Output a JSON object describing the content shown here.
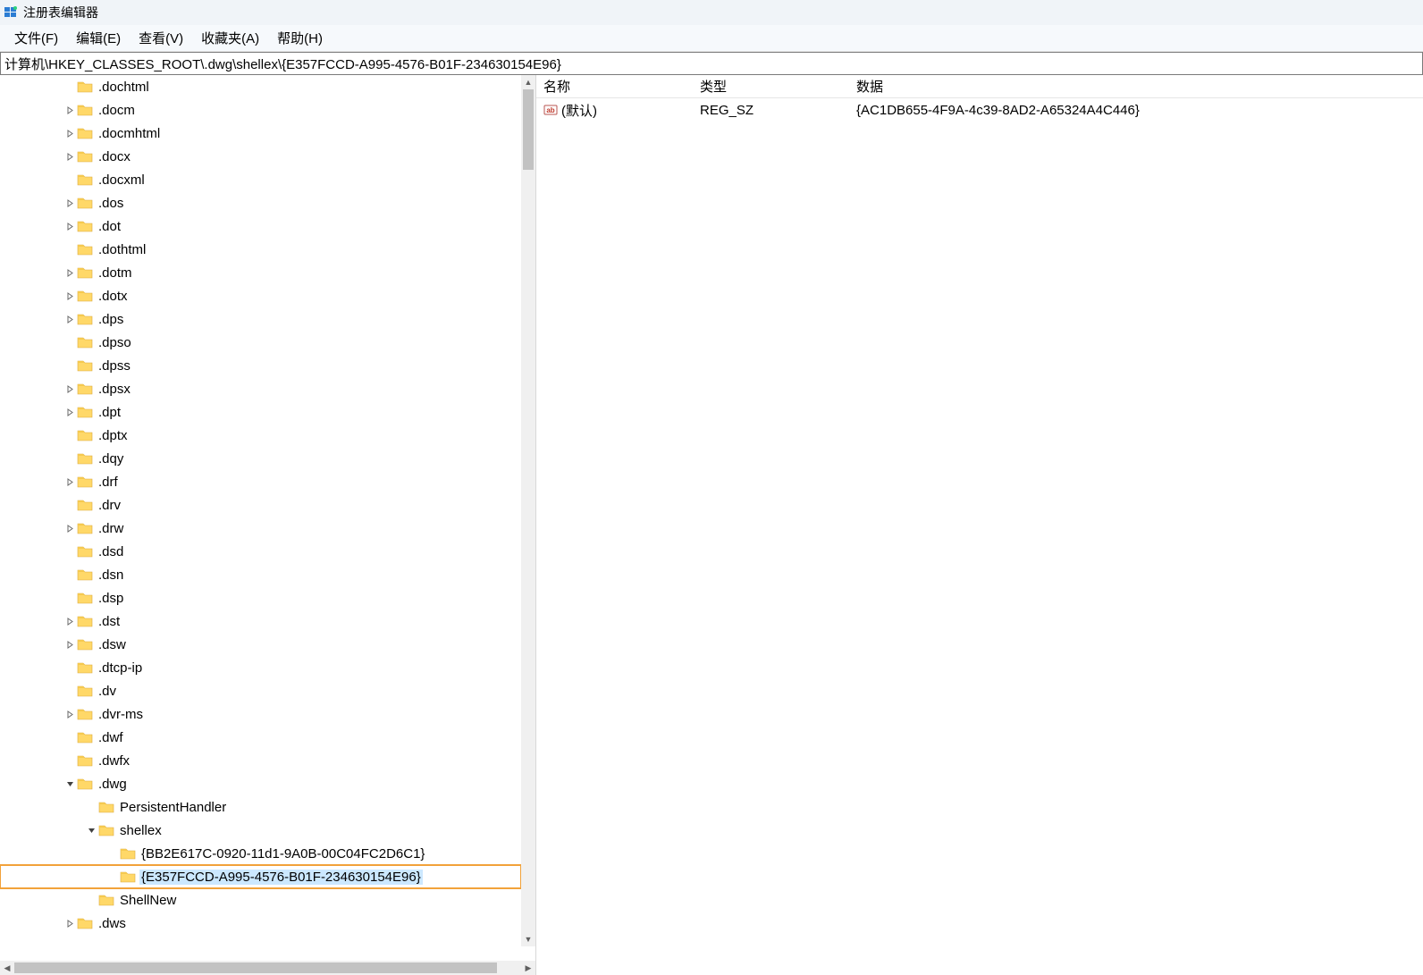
{
  "window": {
    "title": "注册表编辑器"
  },
  "menu": {
    "file": "文件(F)",
    "edit": "编辑(E)",
    "view": "查看(V)",
    "favorites": "收藏夹(A)",
    "help": "帮助(H)"
  },
  "address": "计算机\\HKEY_CLASSES_ROOT\\.dwg\\shellex\\{E357FCCD-A995-4576-B01F-234630154E96}",
  "tree": [
    {
      "indent": 2,
      "expander": "",
      "label": ".dochtml"
    },
    {
      "indent": 2,
      "expander": ">",
      "label": ".docm"
    },
    {
      "indent": 2,
      "expander": ">",
      "label": ".docmhtml"
    },
    {
      "indent": 2,
      "expander": ">",
      "label": ".docx"
    },
    {
      "indent": 2,
      "expander": "",
      "label": ".docxml"
    },
    {
      "indent": 2,
      "expander": ">",
      "label": ".dos"
    },
    {
      "indent": 2,
      "expander": ">",
      "label": ".dot"
    },
    {
      "indent": 2,
      "expander": "",
      "label": ".dothtml"
    },
    {
      "indent": 2,
      "expander": ">",
      "label": ".dotm"
    },
    {
      "indent": 2,
      "expander": ">",
      "label": ".dotx"
    },
    {
      "indent": 2,
      "expander": ">",
      "label": ".dps"
    },
    {
      "indent": 2,
      "expander": "",
      "label": ".dpso"
    },
    {
      "indent": 2,
      "expander": "",
      "label": ".dpss"
    },
    {
      "indent": 2,
      "expander": ">",
      "label": ".dpsx"
    },
    {
      "indent": 2,
      "expander": ">",
      "label": ".dpt"
    },
    {
      "indent": 2,
      "expander": "",
      "label": ".dptx"
    },
    {
      "indent": 2,
      "expander": "",
      "label": ".dqy"
    },
    {
      "indent": 2,
      "expander": ">",
      "label": ".drf"
    },
    {
      "indent": 2,
      "expander": "",
      "label": ".drv"
    },
    {
      "indent": 2,
      "expander": ">",
      "label": ".drw"
    },
    {
      "indent": 2,
      "expander": "",
      "label": ".dsd"
    },
    {
      "indent": 2,
      "expander": "",
      "label": ".dsn"
    },
    {
      "indent": 2,
      "expander": "",
      "label": ".dsp"
    },
    {
      "indent": 2,
      "expander": ">",
      "label": ".dst"
    },
    {
      "indent": 2,
      "expander": ">",
      "label": ".dsw"
    },
    {
      "indent": 2,
      "expander": "",
      "label": ".dtcp-ip"
    },
    {
      "indent": 2,
      "expander": "",
      "label": ".dv"
    },
    {
      "indent": 2,
      "expander": ">",
      "label": ".dvr-ms"
    },
    {
      "indent": 2,
      "expander": "",
      "label": ".dwf"
    },
    {
      "indent": 2,
      "expander": "",
      "label": ".dwfx"
    },
    {
      "indent": 2,
      "expander": "v",
      "label": ".dwg"
    },
    {
      "indent": 3,
      "expander": "",
      "label": "PersistentHandler"
    },
    {
      "indent": 3,
      "expander": "v",
      "label": "shellex"
    },
    {
      "indent": 4,
      "expander": "",
      "label": "{BB2E617C-0920-11d1-9A0B-00C04FC2D6C1}"
    },
    {
      "indent": 4,
      "expander": "",
      "label": "{E357FCCD-A995-4576-B01F-234630154E96}",
      "selected": true
    },
    {
      "indent": 3,
      "expander": "",
      "label": "ShellNew"
    },
    {
      "indent": 2,
      "expander": ">",
      "label": ".dws"
    }
  ],
  "values": {
    "columns": {
      "name": "名称",
      "type": "类型",
      "data": "数据"
    },
    "rows": [
      {
        "name": "(默认)",
        "type": "REG_SZ",
        "data": "{AC1DB655-4F9A-4c39-8AD2-A65324A4C446}"
      }
    ]
  }
}
